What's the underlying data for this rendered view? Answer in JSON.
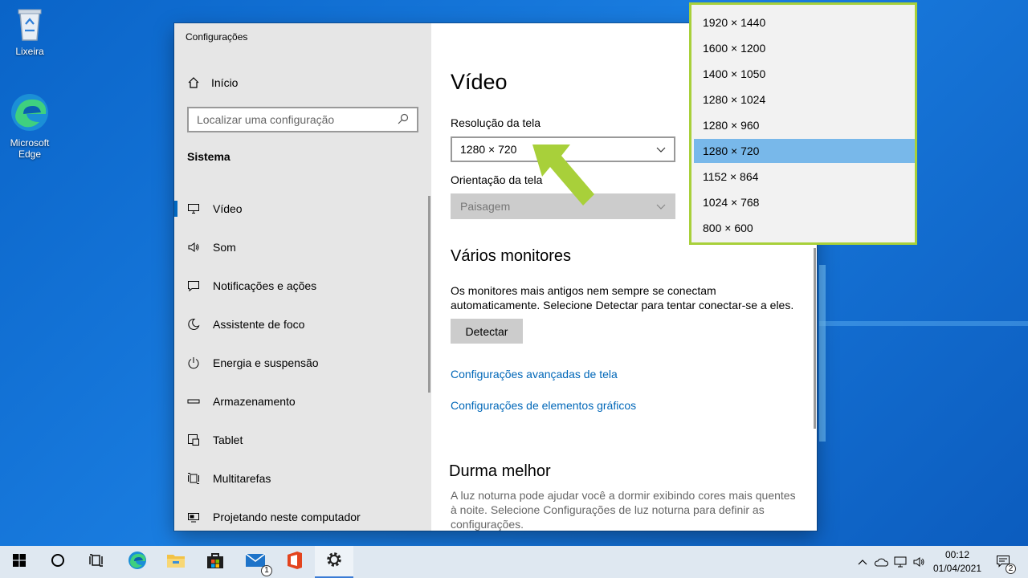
{
  "desktop": {
    "icons": [
      {
        "label": "Lixeira",
        "icon": "recycle-bin-icon"
      },
      {
        "label": "Microsoft Edge",
        "icon": "edge-icon"
      }
    ]
  },
  "window": {
    "title": "Configurações"
  },
  "sidebar": {
    "home_label": "Início",
    "search_placeholder": "Localizar uma configuração",
    "section_label": "Sistema",
    "items": [
      {
        "label": "Vídeo",
        "icon": "monitor-icon",
        "active": true
      },
      {
        "label": "Som",
        "icon": "speaker-icon"
      },
      {
        "label": "Notificações e ações",
        "icon": "notification-icon"
      },
      {
        "label": "Assistente de foco",
        "icon": "moon-icon"
      },
      {
        "label": "Energia e suspensão",
        "icon": "power-icon"
      },
      {
        "label": "Armazenamento",
        "icon": "storage-icon"
      },
      {
        "label": "Tablet",
        "icon": "tablet-icon"
      },
      {
        "label": "Multitarefas",
        "icon": "multitask-icon"
      },
      {
        "label": "Projetando neste computador",
        "icon": "project-icon"
      }
    ]
  },
  "content": {
    "page_title": "Vídeo",
    "resolution_label": "Resolução da tela",
    "resolution_value": "1280 × 720",
    "orientation_label": "Orientação da tela",
    "orientation_value": "Paisagem",
    "multi_title": "Vários monitores",
    "multi_text": "Os monitores mais antigos nem sempre se conectam automaticamente. Selecione Detectar para tentar conectar-se a eles.",
    "detect_label": "Detectar",
    "link_advanced": "Configurações avançadas de tela",
    "link_graphics": "Configurações de elementos gráficos",
    "sleep_title": "Durma melhor",
    "sleep_text": "A luz noturna pode ajudar você a dormir exibindo cores mais quentes à noite. Selecione Configurações de luz noturna para definir as configurações."
  },
  "resolution_options": [
    "1920 × 1440",
    "1600 × 1200",
    "1400 × 1050",
    "1280 × 1024",
    "1280 × 960",
    "1280 × 720",
    "1152 × 864",
    "1024 × 768",
    "800 × 600"
  ],
  "selected_resolution_index": 5,
  "taskbar": {
    "clock_time": "00:12",
    "clock_date": "01/04/2021",
    "mail_badge": "1",
    "notification_badge": "2"
  },
  "colors": {
    "accent": "#0067c0",
    "link": "#0067b8",
    "highlight_selected": "#78b8ea",
    "annotation_green": "#a8d03a"
  }
}
